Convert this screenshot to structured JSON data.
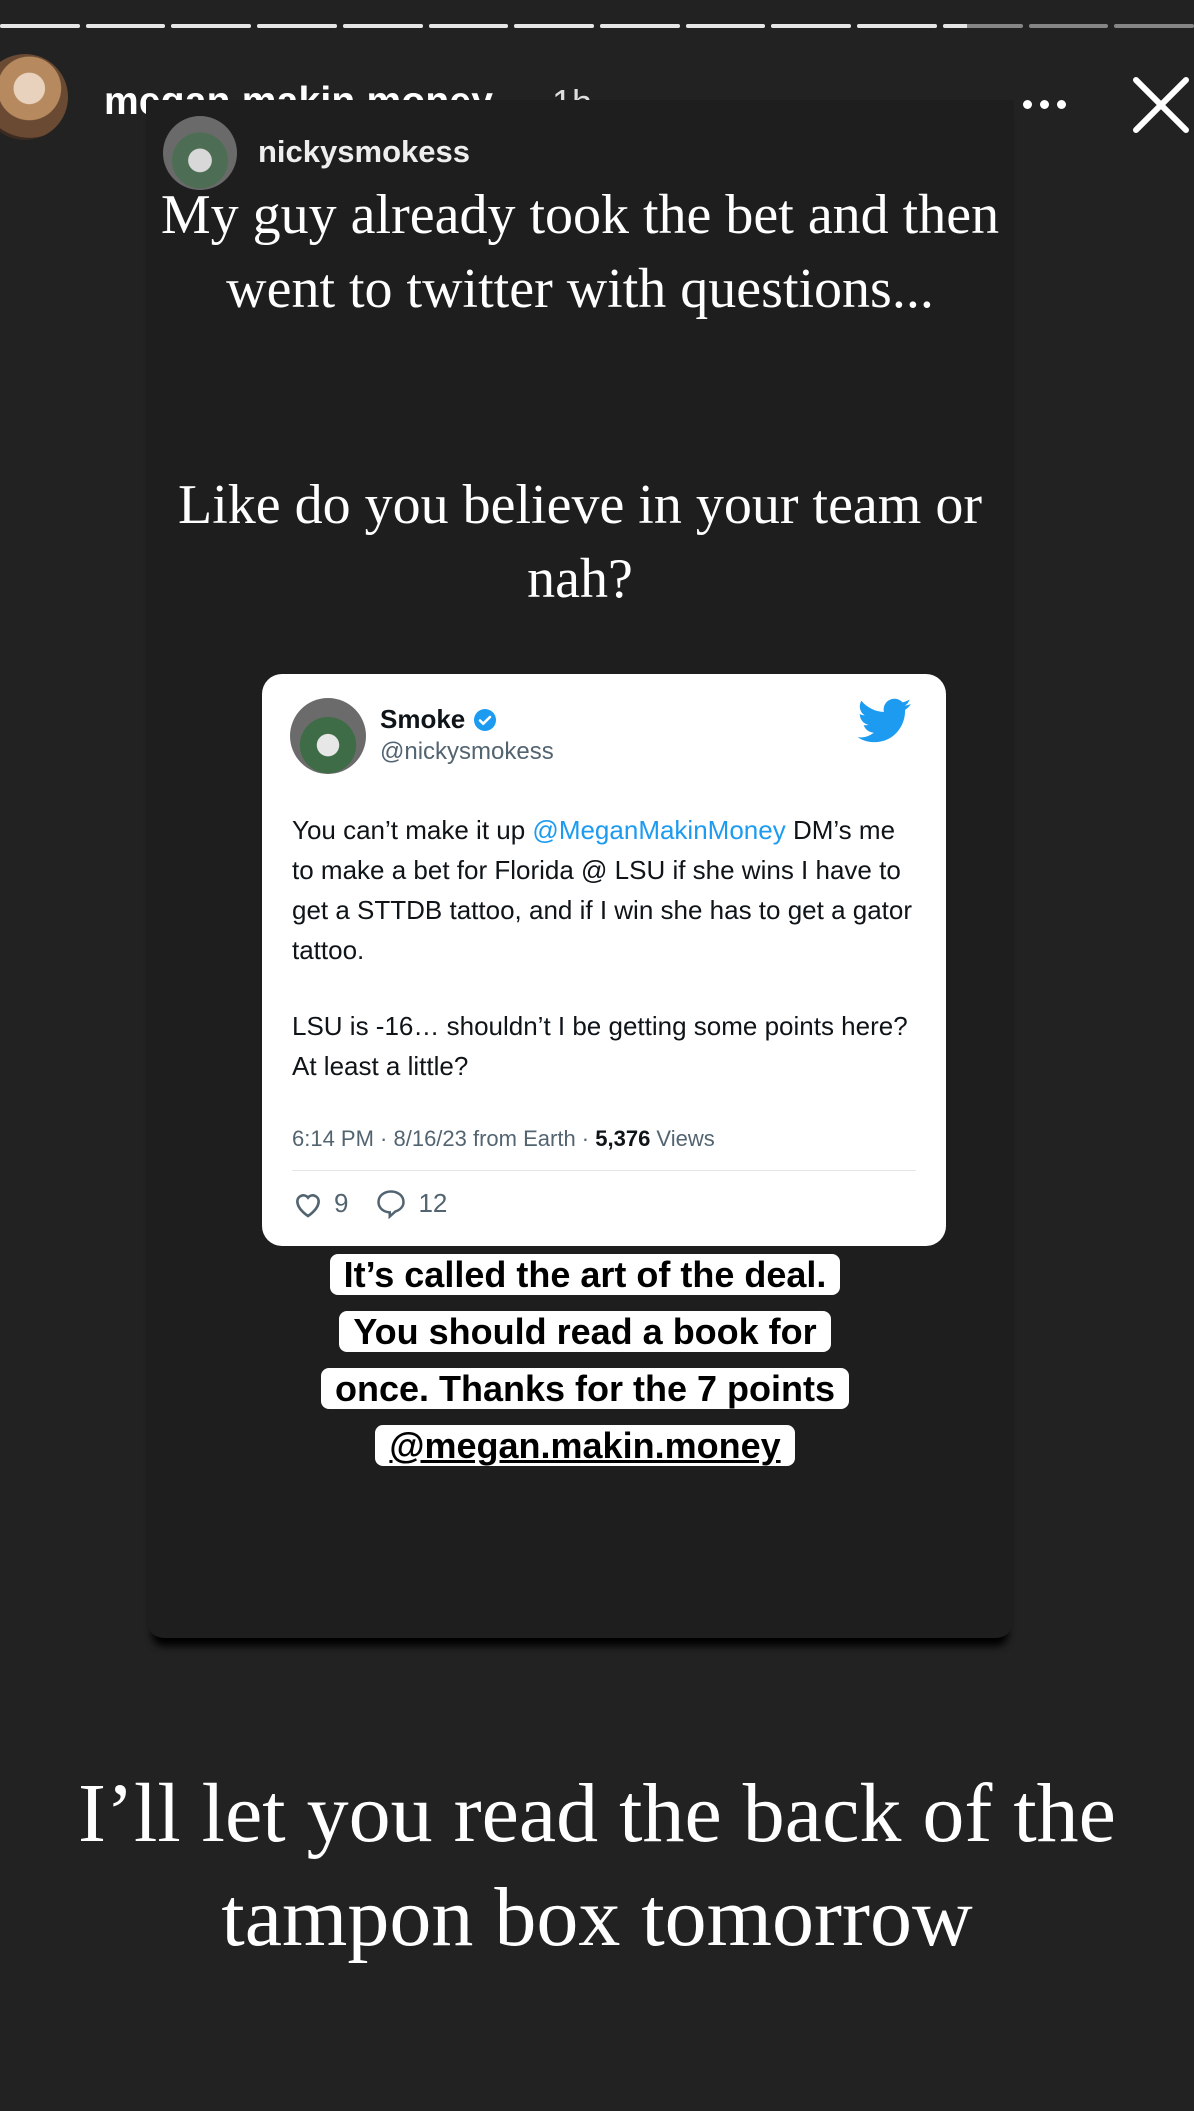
{
  "progress": {
    "segments": 14,
    "completed": 11,
    "active_fraction": 0.3
  },
  "header": {
    "username": "megan.makin.money",
    "time_ago": "1h",
    "more_icon": "more-horizontal-icon",
    "close_icon": "close-icon"
  },
  "reshare": {
    "original_username": "nickysmokess",
    "caption_line1": "My guy already took the bet and then went to twitter with questions...",
    "caption_line2": "Like do you believe in your team or nah?"
  },
  "tweet": {
    "display_name": "Smoke",
    "handle": "@nickysmokess",
    "body_prefix": "You can’t make it up ",
    "mention": "@MeganMakinMoney",
    "body_suffix": " DM’s me to make a bet for Florida @ LSU if she wins I have to get a STTDB tattoo, and if I win she has to get a gator tattoo.",
    "body_paragraph2": "LSU is -16… shouldn’t I be getting some points here? At least a little?",
    "meta_time": "6:14 PM · 8/16/23 from Earth · ",
    "views_count": "5,376",
    "views_label": " Views",
    "likes": "9",
    "replies": "12",
    "brand_color": "#1d9bf0"
  },
  "sticker": {
    "text": "It’s called the art of the deal. You should read a book for once. Thanks for the 7 points",
    "tag": "@megan.makin.money"
  },
  "bottom_caption": "I’ll let you read the back of the tampon box tomorrow"
}
